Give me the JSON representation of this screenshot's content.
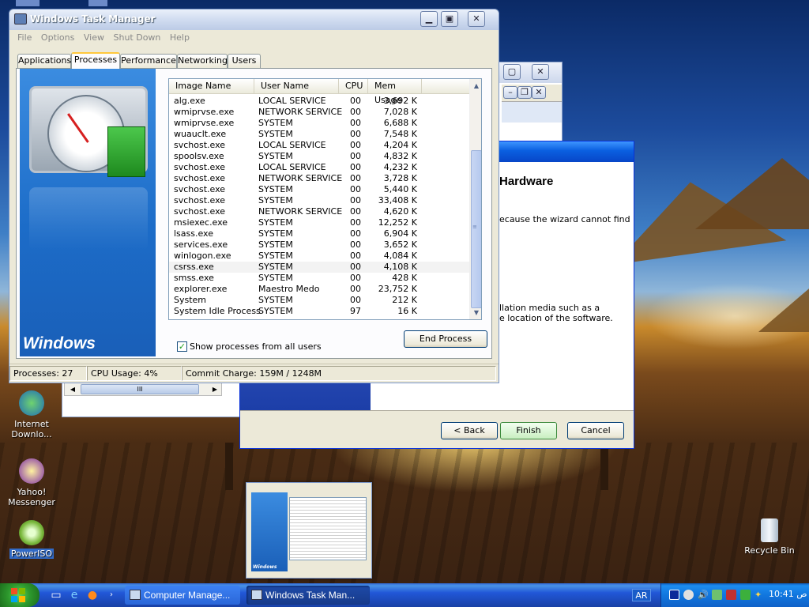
{
  "desktop": {
    "icons": [
      {
        "label": "Internet Downlo..."
      },
      {
        "label": "Yahoo! Messenger"
      },
      {
        "label": "PowerISO"
      },
      {
        "label": "Recycle Bin"
      }
    ]
  },
  "bg_window": {
    "scroll_grip": "III"
  },
  "wizard": {
    "heading": "Hardware",
    "text1": "ecause the wizard cannot find",
    "text2_line1": "llation media such as a",
    "text2_line2": "e location of the software.",
    "back_label": "< Back",
    "finish_label": "Finish",
    "cancel_label": "Cancel"
  },
  "taskmgr": {
    "title": "Windows Task Manager",
    "menu": [
      "File",
      "Options",
      "View",
      "Shut Down",
      "Help"
    ],
    "tabs": [
      {
        "label": "Applications",
        "active": false
      },
      {
        "label": "Processes",
        "active": true
      },
      {
        "label": "Performance",
        "active": false
      },
      {
        "label": "Networking",
        "active": false
      },
      {
        "label": "Users",
        "active": false
      }
    ],
    "brand_text": "Windows",
    "columns": [
      "Image Name",
      "User Name",
      "CPU",
      "Mem Usage"
    ],
    "processes": [
      {
        "name": "alg.exe",
        "user": "LOCAL SERVICE",
        "cpu": "00",
        "mem": "3,692 K"
      },
      {
        "name": "wmiprvse.exe",
        "user": "NETWORK SERVICE",
        "cpu": "00",
        "mem": "7,028 K"
      },
      {
        "name": "wmiprvse.exe",
        "user": "SYSTEM",
        "cpu": "00",
        "mem": "6,688 K"
      },
      {
        "name": "wuauclt.exe",
        "user": "SYSTEM",
        "cpu": "00",
        "mem": "7,548 K"
      },
      {
        "name": "svchost.exe",
        "user": "LOCAL SERVICE",
        "cpu": "00",
        "mem": "4,204 K"
      },
      {
        "name": "spoolsv.exe",
        "user": "SYSTEM",
        "cpu": "00",
        "mem": "4,832 K"
      },
      {
        "name": "svchost.exe",
        "user": "LOCAL SERVICE",
        "cpu": "00",
        "mem": "4,232 K"
      },
      {
        "name": "svchost.exe",
        "user": "NETWORK SERVICE",
        "cpu": "00",
        "mem": "3,728 K"
      },
      {
        "name": "svchost.exe",
        "user": "SYSTEM",
        "cpu": "00",
        "mem": "5,440 K"
      },
      {
        "name": "svchost.exe",
        "user": "SYSTEM",
        "cpu": "00",
        "mem": "33,408 K"
      },
      {
        "name": "svchost.exe",
        "user": "NETWORK SERVICE",
        "cpu": "00",
        "mem": "4,620 K"
      },
      {
        "name": "msiexec.exe",
        "user": "SYSTEM",
        "cpu": "00",
        "mem": "12,252 K"
      },
      {
        "name": "lsass.exe",
        "user": "SYSTEM",
        "cpu": "00",
        "mem": "6,904 K"
      },
      {
        "name": "services.exe",
        "user": "SYSTEM",
        "cpu": "00",
        "mem": "3,652 K"
      },
      {
        "name": "winlogon.exe",
        "user": "SYSTEM",
        "cpu": "00",
        "mem": "4,084 K"
      },
      {
        "name": "csrss.exe",
        "user": "SYSTEM",
        "cpu": "00",
        "mem": "4,108 K",
        "highlight": true
      },
      {
        "name": "smss.exe",
        "user": "SYSTEM",
        "cpu": "00",
        "mem": "428 K"
      },
      {
        "name": "explorer.exe",
        "user": "Maestro Medo",
        "cpu": "00",
        "mem": "23,752 K"
      },
      {
        "name": "System",
        "user": "SYSTEM",
        "cpu": "00",
        "mem": "212 K"
      },
      {
        "name": "System Idle Process",
        "user": "SYSTEM",
        "cpu": "97",
        "mem": "16 K"
      }
    ],
    "show_all_label": "Show processes from all users",
    "show_all_checked": true,
    "end_process_label": "End Process",
    "status": {
      "processes": "Processes: 27",
      "cpu": "CPU Usage: 4%",
      "commit": "Commit Charge: 159M / 1248M"
    }
  },
  "taskbar": {
    "tasks": [
      {
        "label": "Computer Manage...",
        "active": false
      },
      {
        "label": "Windows Task Man...",
        "active": true
      }
    ],
    "lang": "AR",
    "clock": "10:41 ص"
  }
}
